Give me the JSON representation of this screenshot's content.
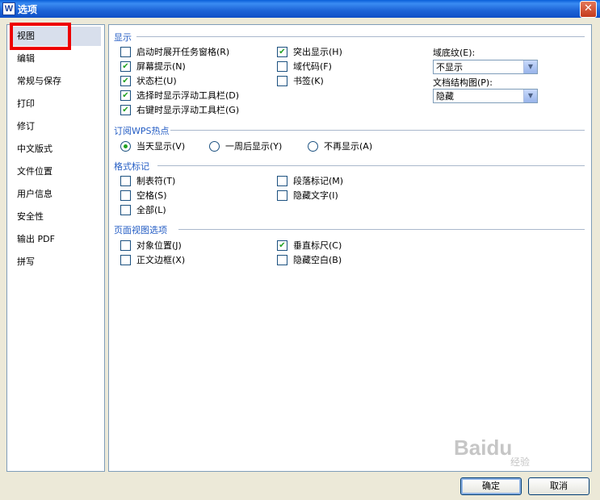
{
  "window": {
    "title": "选项",
    "app_icon": "W",
    "close_glyph": "✕"
  },
  "sidebar": {
    "items": [
      {
        "label": "视图",
        "selected": true
      },
      {
        "label": "编辑"
      },
      {
        "label": "常规与保存"
      },
      {
        "label": "打印"
      },
      {
        "label": "修订"
      },
      {
        "label": "中文版式"
      },
      {
        "label": "文件位置"
      },
      {
        "label": "用户信息"
      },
      {
        "label": "安全性"
      },
      {
        "label": "输出 PDF"
      },
      {
        "label": "拼写"
      }
    ]
  },
  "display": {
    "title": "显示",
    "left": [
      {
        "label": "启动时展开任务窗格",
        "key": "(R)",
        "checked": false
      },
      {
        "label": "屏幕提示",
        "key": "(N)",
        "checked": true
      },
      {
        "label": "状态栏",
        "key": "(U)",
        "checked": true
      },
      {
        "label": "选择时显示浮动工具栏",
        "key": "(D)",
        "checked": true
      },
      {
        "label": "右键时显示浮动工具栏",
        "key": "(G)",
        "checked": true
      }
    ],
    "middle": [
      {
        "label": "突出显示",
        "key": "(H)",
        "checked": true
      },
      {
        "label": "域代码",
        "key": "(F)",
        "checked": false
      },
      {
        "label": "书签",
        "key": "(K)",
        "checked": false
      }
    ],
    "field_shading": {
      "label": "域底纹",
      "key": "(E):",
      "value": "不显示"
    },
    "doc_map": {
      "label": "文档结构图",
      "key": "(P):",
      "value": "隐藏"
    }
  },
  "subscribe": {
    "title": "订阅WPS热点",
    "options": [
      {
        "label": "当天显示",
        "key": "(V)",
        "selected": true
      },
      {
        "label": "一周后显示",
        "key": "(Y)",
        "selected": false
      },
      {
        "label": "不再显示",
        "key": "(A)",
        "selected": false
      }
    ]
  },
  "format_marks": {
    "title": "格式标记",
    "left": [
      {
        "label": "制表符",
        "key": "(T)",
        "checked": false
      },
      {
        "label": "空格",
        "key": "(S)",
        "checked": false
      },
      {
        "label": "全部",
        "key": "(L)",
        "checked": false
      }
    ],
    "middle": [
      {
        "label": "段落标记",
        "key": "(M)",
        "checked": false
      },
      {
        "label": "隐藏文字",
        "key": "(I)",
        "checked": false
      }
    ]
  },
  "page_view": {
    "title": "页面视图选项",
    "left": [
      {
        "label": "对象位置",
        "key": "(J)",
        "checked": false
      },
      {
        "label": "正文边框",
        "key": "(X)",
        "checked": false
      }
    ],
    "middle": [
      {
        "label": "垂直标尺",
        "key": "(C)",
        "checked": true
      },
      {
        "label": "隐藏空白",
        "key": "(B)",
        "checked": false
      }
    ]
  },
  "buttons": {
    "ok": "确定",
    "cancel": "取消"
  },
  "watermark": {
    "brand": "Baidu",
    "sub": "经验"
  },
  "colors": {
    "accent": "#245dc4",
    "check": "#21a121",
    "highlight": "#e00000"
  }
}
